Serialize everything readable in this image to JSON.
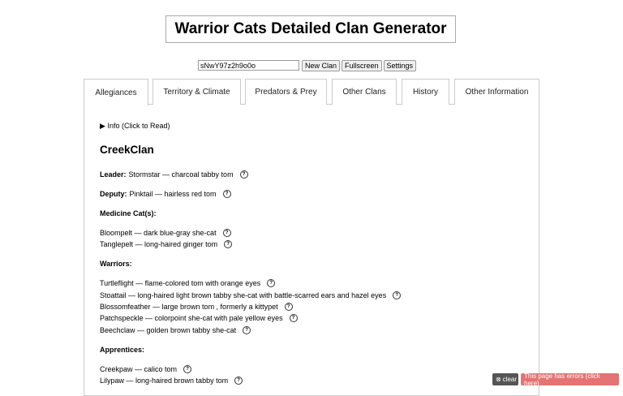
{
  "title": "Warrior Cats Detailed Clan Generator",
  "controls": {
    "seed_value": "sNwY97z2h9o0o",
    "new_clan": "New Clan",
    "fullscreen": "Fullscreen",
    "settings": "Settings"
  },
  "tabs": [
    {
      "label": "Allegiances"
    },
    {
      "label": "Territory & Climate"
    },
    {
      "label": "Predators & Prey"
    },
    {
      "label": "Other Clans"
    },
    {
      "label": "History"
    },
    {
      "label": "Other Information"
    }
  ],
  "info_toggle": "Info (Click to Read)",
  "clan_name": "CreekClan",
  "leader": {
    "label": "Leader:",
    "text": "Stormstar — charcoal tabby tom"
  },
  "deputy": {
    "label": "Deputy:",
    "text": "Pinktail — hairless red tom"
  },
  "medicine_heading": "Medicine Cat(s):",
  "medicine_cats": [
    "Bloompelt — dark blue-gray she-cat",
    "Tanglepelt — long-haired ginger tom"
  ],
  "warriors_heading": "Warriors:",
  "warriors": [
    "Turtleflight — flame-colored tom with orange eyes",
    "Stoattail — long-haired light brown tabby she-cat with battle-scarred ears and hazel eyes",
    "Blossomfeather — large brown tom , formerly a kittypet",
    "Patchspeckle — colorpoint she-cat with pale yellow eyes",
    "Beechclaw — golden brown tabby she-cat"
  ],
  "apprentices_heading": "Apprentices:",
  "apprentices": [
    "Creekpaw — calico tom",
    "Lilypaw — long-haired brown tabby tom"
  ],
  "help_icon": "?",
  "toasts": {
    "clear": "clear",
    "errors": "This page has errors (click here)"
  }
}
